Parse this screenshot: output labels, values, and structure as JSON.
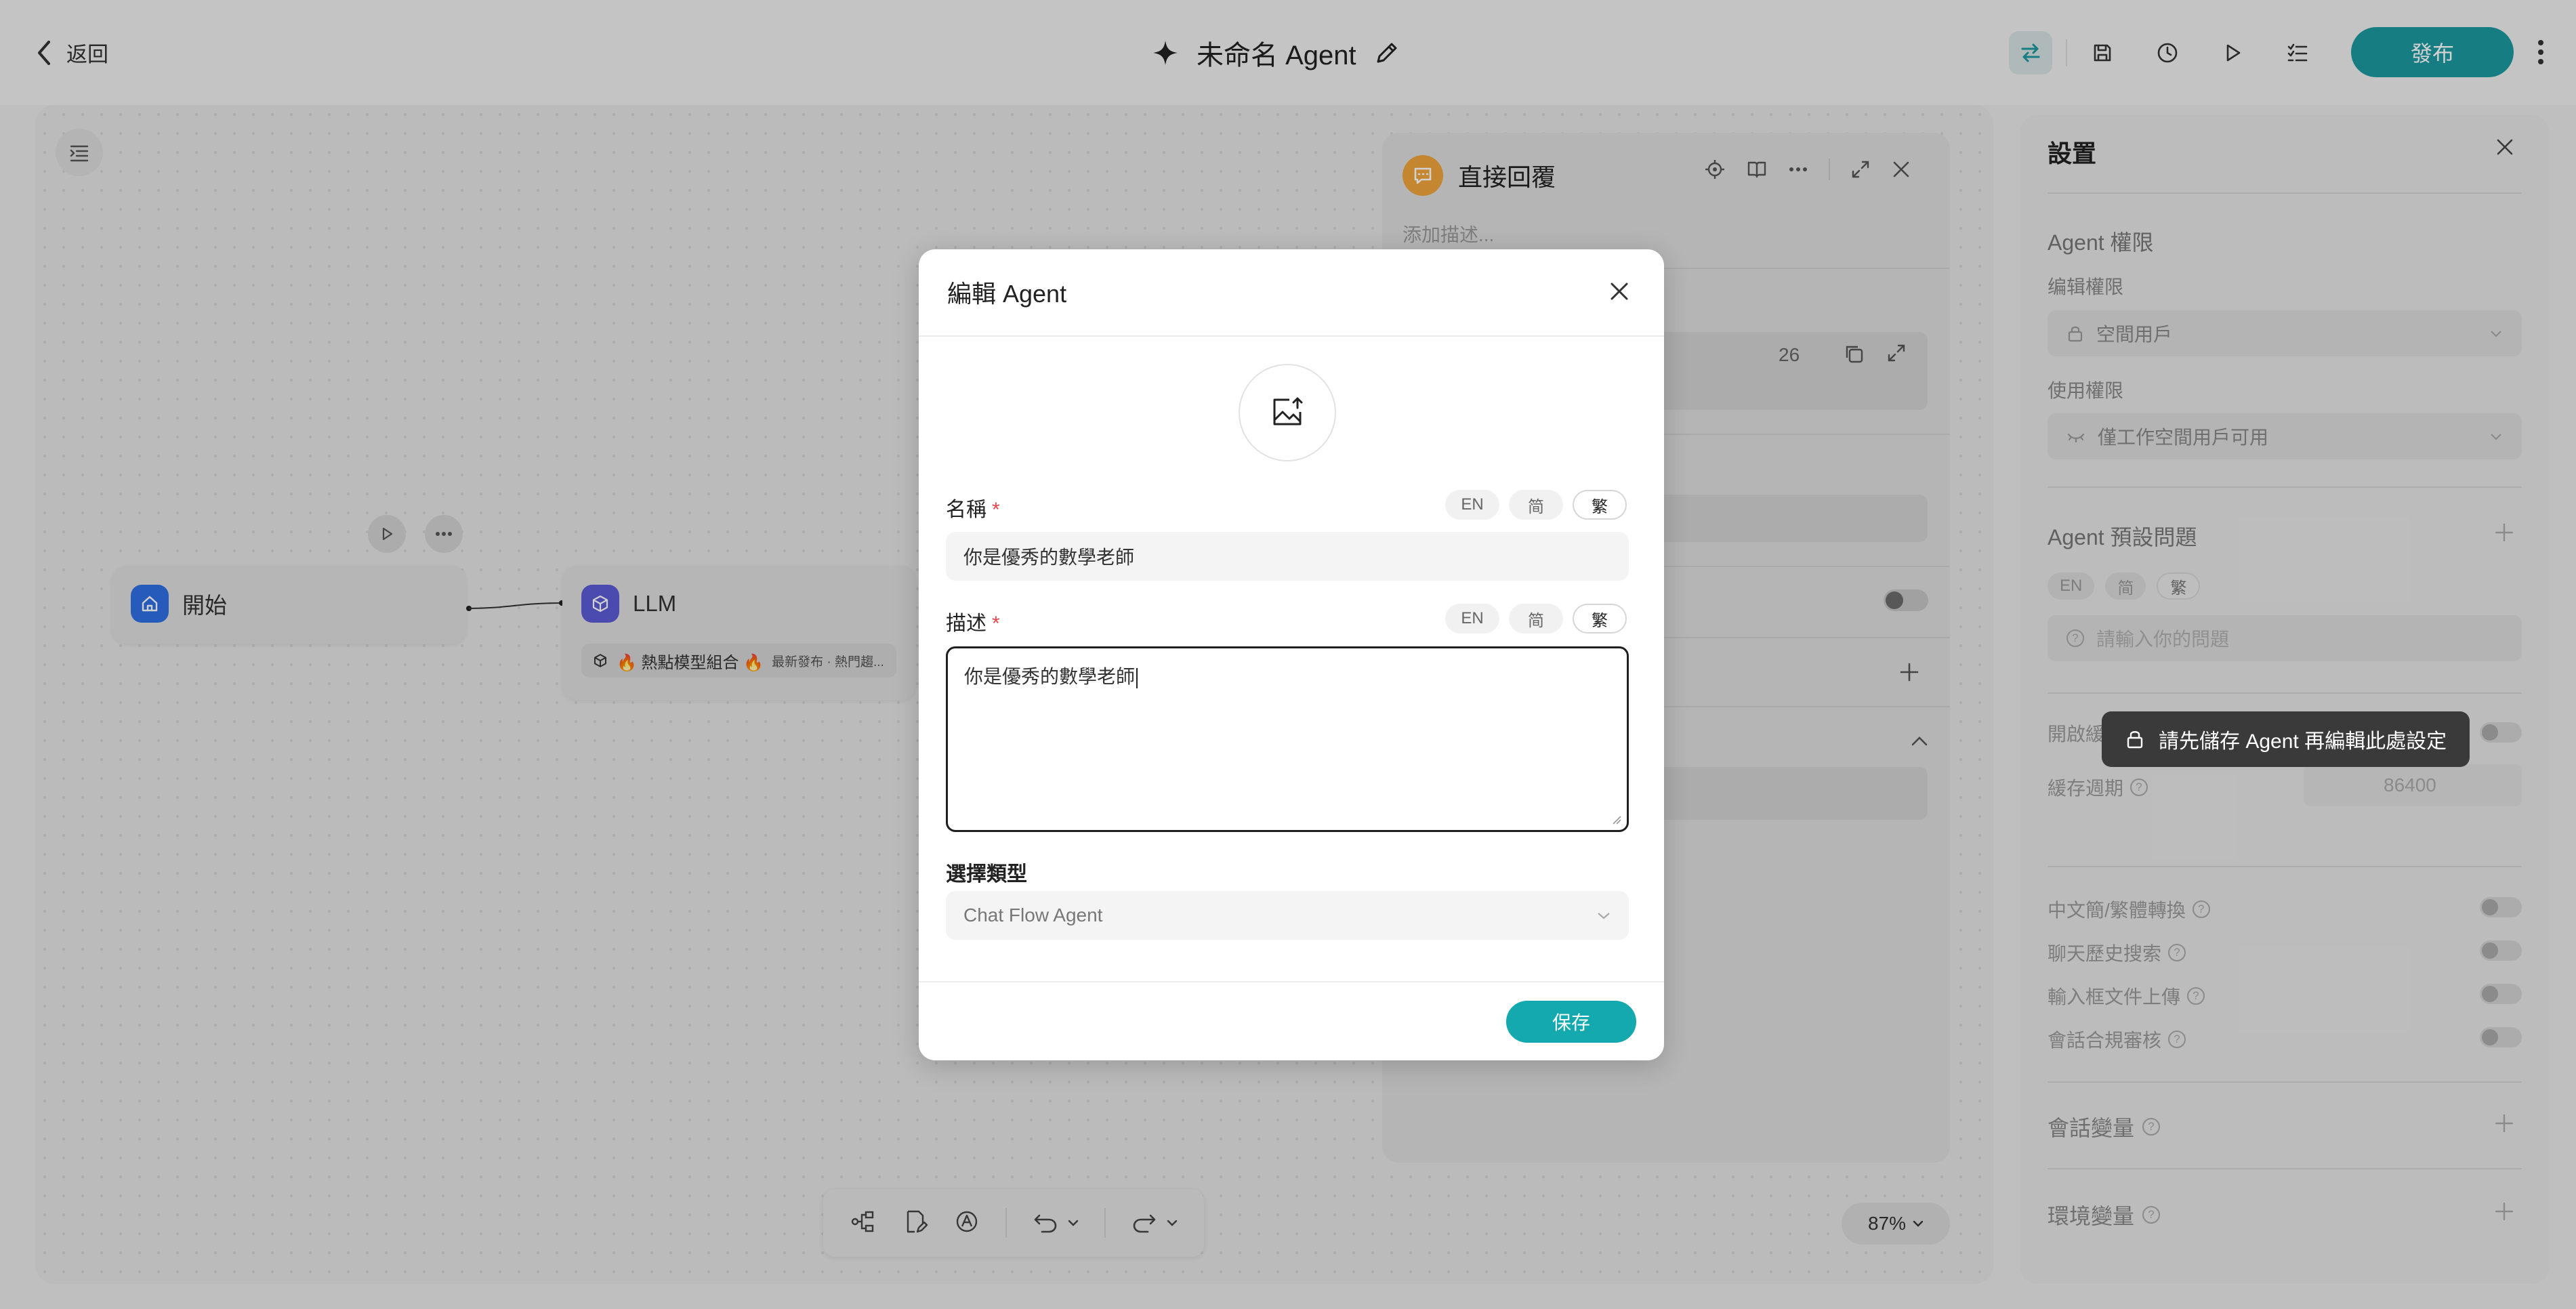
{
  "header": {
    "back_label": "返回",
    "title": "未命名 Agent",
    "publish_label": "發布"
  },
  "canvas": {
    "nodes": {
      "start": {
        "label": "開始"
      },
      "llm": {
        "label": "LLM",
        "model": "🔥 熱點模型組合 🔥",
        "model_tag": "最新發布 · 熱門趨..."
      }
    },
    "zoom": "87%"
  },
  "reply_panel": {
    "title": "直接回覆",
    "description_placeholder": "添加描述...",
    "counter": "26"
  },
  "settings": {
    "title": "設置",
    "agent_permissions": {
      "heading": "Agent 權限",
      "edit_label": "编辑權限",
      "edit_value": "空間用戶",
      "use_label": "使用權限",
      "use_value": "僅工作空間用戶可用"
    },
    "preset_questions": {
      "heading": "Agent 預設問題",
      "langs": [
        "EN",
        "简",
        "繁"
      ],
      "placeholder": "請輸入你的問題"
    },
    "cache": {
      "enable_label": "開啟緩",
      "period_label": "緩存週期",
      "period_value": "86400"
    },
    "toggles": [
      "中文簡/繁體轉換",
      "聊天歷史搜索",
      "輸入框文件上傳",
      "會話合規審核"
    ],
    "session_vars": "會話變量",
    "env_vars": "環境變量"
  },
  "tooltip": {
    "text": "請先儲存 Agent 再編輯此處設定"
  },
  "modal": {
    "title": "編輯 Agent",
    "name_label": "名稱",
    "required_mark": "*",
    "langs": [
      "EN",
      "简",
      "繁"
    ],
    "name_value": "你是優秀的數學老師",
    "desc_label": "描述",
    "desc_value": "你是優秀的數學老師",
    "type_label": "選擇類型",
    "type_value": "Chat Flow Agent",
    "save_label": "保存"
  },
  "colors": {
    "accent": "#13a9ae",
    "publish": "#1b9a9f",
    "required": "#e5484d",
    "reply_badge": "#f0a43b",
    "start_badge": "#2f6fe4",
    "llm_badge": "#5b5bd6"
  }
}
